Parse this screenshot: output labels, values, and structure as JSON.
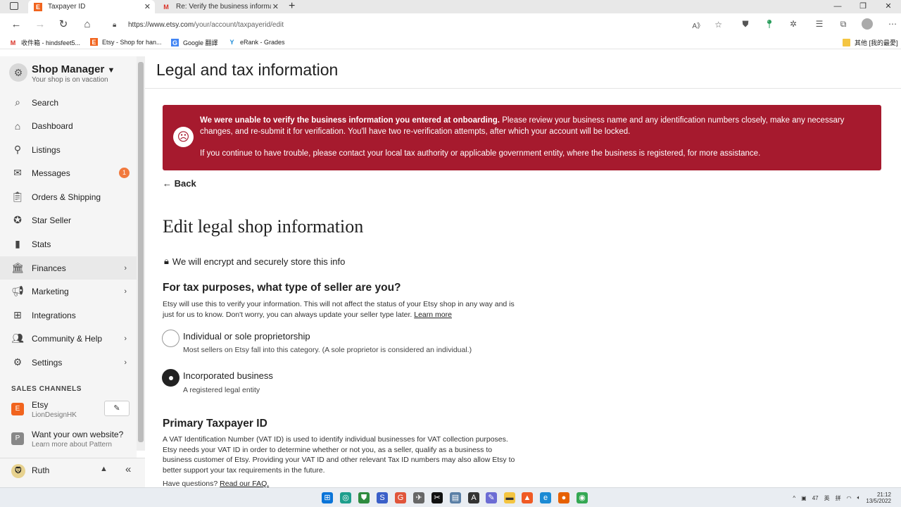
{
  "browser": {
    "tabs": [
      {
        "title": "Taxpayer ID",
        "icon": "etsy-icon"
      },
      {
        "title": "Re: Verify the business informatio",
        "icon": "gmail-icon"
      }
    ],
    "new_tab": "+",
    "url_host": "https://www.etsy.com",
    "url_path": "/your/account/taxpayerid/edit",
    "bookmarks": [
      {
        "label": "收件箱 - hindsfeet5...",
        "icon": "gmail-icon"
      },
      {
        "label": "Etsy - Shop for han...",
        "icon": "etsy-icon"
      },
      {
        "label": "Google 翻譯",
        "icon": "google-translate-icon"
      },
      {
        "label": "eRank - Grades",
        "icon": "erank-icon"
      }
    ],
    "other_bookmarks": "其他 [我的最愛]"
  },
  "sidebar": {
    "title": "Shop Manager",
    "subtitle": "Your shop is on vacation",
    "items": [
      {
        "label": "Search",
        "icon": "search-icon"
      },
      {
        "label": "Dashboard",
        "icon": "home-icon"
      },
      {
        "label": "Listings",
        "icon": "listings-icon"
      },
      {
        "label": "Messages",
        "icon": "mail-icon",
        "badge": "1"
      },
      {
        "label": "Orders & Shipping",
        "icon": "clipboard-icon"
      },
      {
        "label": "Star Seller",
        "icon": "star-badge-icon"
      },
      {
        "label": "Stats",
        "icon": "stats-icon"
      },
      {
        "label": "Finances",
        "icon": "bank-icon"
      },
      {
        "label": "Marketing",
        "icon": "megaphone-icon"
      },
      {
        "label": "Integrations",
        "icon": "grid-icon"
      },
      {
        "label": "Community & Help",
        "icon": "people-icon"
      },
      {
        "label": "Settings",
        "icon": "gear-icon"
      }
    ],
    "sales_channels_heading": "SALES CHANNELS",
    "channels": [
      {
        "name": "Etsy",
        "sub": "LionDesignHK",
        "icon_letter": "E"
      },
      {
        "name": "Want your own website?",
        "sub": "Learn more about Pattern",
        "icon_letter": "P"
      }
    ],
    "user": {
      "name": "Ruth"
    }
  },
  "main": {
    "header_title": "Legal and tax information",
    "alert": {
      "bold": "We were unable to verify the business information you entered at onboarding.",
      "text": " Please review your business name and any identification numbers closely, make any necessary changes, and re-submit it for verification. You'll have two re-verification attempts, after which your account will be locked.",
      "text2": "If you continue to have trouble, please contact your local tax authority or applicable government entity, where the business is registered, for more assistance."
    },
    "back_label": "Back",
    "edit_title": "Edit legal shop information",
    "encrypt_note": "We will encrypt and securely store this info",
    "seller_question": "For tax purposes, what type of seller are you?",
    "seller_desc": "Etsy will use this to verify your information. This will not affect the status of your Etsy shop in any way and is just for us to know. Don't worry, you can always update your seller type later.",
    "learn_more": "Learn more",
    "options": [
      {
        "label": "Individual or sole proprietorship",
        "sub": "Most sellers on Etsy fall into this category. (A sole proprietor is considered an individual.)",
        "selected": false
      },
      {
        "label": "Incorporated business",
        "sub": "A registered legal entity",
        "selected": true
      }
    ],
    "taxpayer_heading": "Primary Taxpayer ID",
    "taxpayer_desc": "A VAT Identification Number (VAT ID) is used to identify individual businesses for VAT collection purposes. Etsy needs your VAT ID in order to determine whether or not you, as a seller, qualify as a business to business customer of Etsy. Providing your VAT ID and other relevant Tax ID numbers may also allow Etsy to better support your tax requirements in the future.",
    "faq_prefix": "Have questions?",
    "faq_link": "Read our FAQ."
  },
  "taskbar": {
    "time": "21:12",
    "date": "13/5/2022",
    "lang1": "英",
    "lang2": "拼",
    "temp": "47"
  },
  "colors": {
    "alert_bg": "#a61a2e",
    "badge": "#f1641e",
    "etsy_orange": "#f1641e"
  }
}
